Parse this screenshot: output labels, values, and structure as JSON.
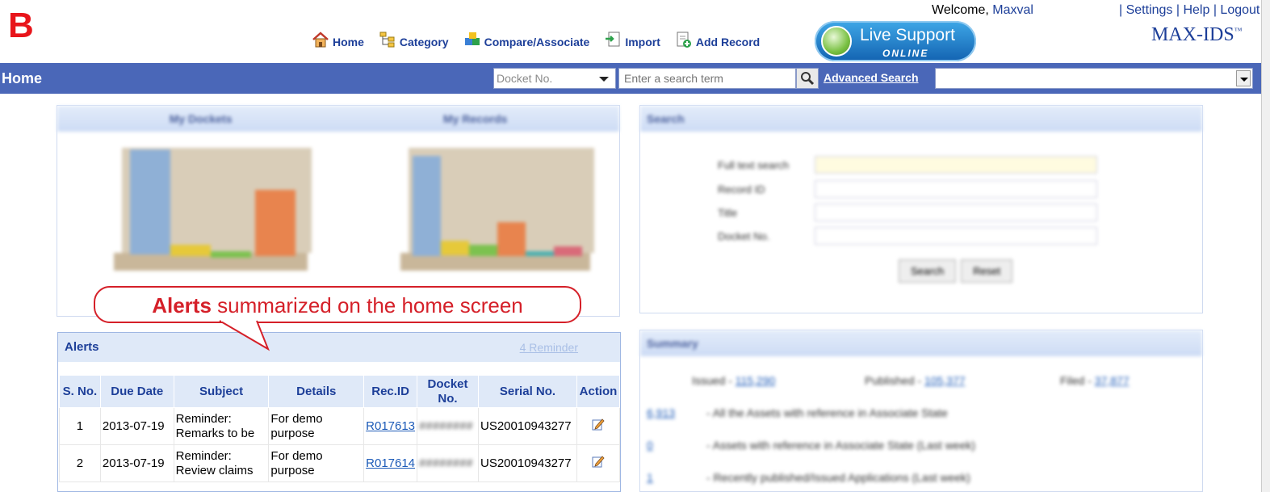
{
  "badge": "B",
  "header": {
    "welcome_prefix": "Welcome,",
    "username": "Maxval",
    "links": "| Settings | Help | Logout",
    "brand": "MAX-IDS",
    "brand_tm": "™"
  },
  "nav": {
    "items": [
      {
        "label": "Home",
        "icon": "home-icon"
      },
      {
        "label": "Category",
        "icon": "category-icon"
      },
      {
        "label": "Compare/Associate",
        "icon": "compare-icon"
      },
      {
        "label": "Import",
        "icon": "import-icon"
      },
      {
        "label": "Add Record",
        "icon": "add-record-icon"
      }
    ]
  },
  "live_support": {
    "title": "Live Support",
    "status": "ONLINE"
  },
  "bar": {
    "title": "Home",
    "docket_select": "Docket No.",
    "search_placeholder": "Enter a search term",
    "advanced_search": "Advanced Search"
  },
  "callout": {
    "bold": "Alerts",
    "rest": " summarized on the home screen"
  },
  "alerts": {
    "title": "Alerts",
    "reminder": "4 Reminder",
    "columns": [
      "S. No.",
      "Due Date",
      "Subject",
      "Details",
      "Rec.ID",
      "Docket No.",
      "Serial No.",
      "Action"
    ],
    "rows": [
      {
        "sno": "1",
        "due": "2013-07-19",
        "subject": "Reminder: Remarks to be",
        "details": "For demo purpose",
        "recid": "R017613",
        "docket": "########",
        "serial": "US20010943277"
      },
      {
        "sno": "2",
        "due": "2013-07-19",
        "subject": "Reminder: Review claims",
        "details": "For demo purpose",
        "recid": "R017614",
        "docket": "########",
        "serial": "US20010943277"
      }
    ]
  },
  "panels": {
    "my_dockets": "My Dockets",
    "my_records": "My Records",
    "search": "Search",
    "summary": "Summary",
    "search_fields": [
      "Full text search",
      "Record ID",
      "Title",
      "Docket No."
    ],
    "search_buttons": [
      "Search",
      "Reset"
    ],
    "summary_issued": "Issued -",
    "summary_issued_val": "115,290",
    "summary_published": "Published -",
    "summary_published_val": "105,377",
    "summary_filed": "Filed -",
    "summary_filed_val": "37,877",
    "summary_lines": [
      {
        "count": "6,913",
        "text": "- All the Assets with reference in Associate State"
      },
      {
        "count": "0",
        "text": "- Assets with reference in Associate State (Last week)"
      },
      {
        "count": "1",
        "text": "- Recently published/Issued Applications (Last week)"
      }
    ]
  },
  "colors": {
    "bar": "#4a67b8",
    "accent": "#1d3f99",
    "callout": "#d52029"
  }
}
